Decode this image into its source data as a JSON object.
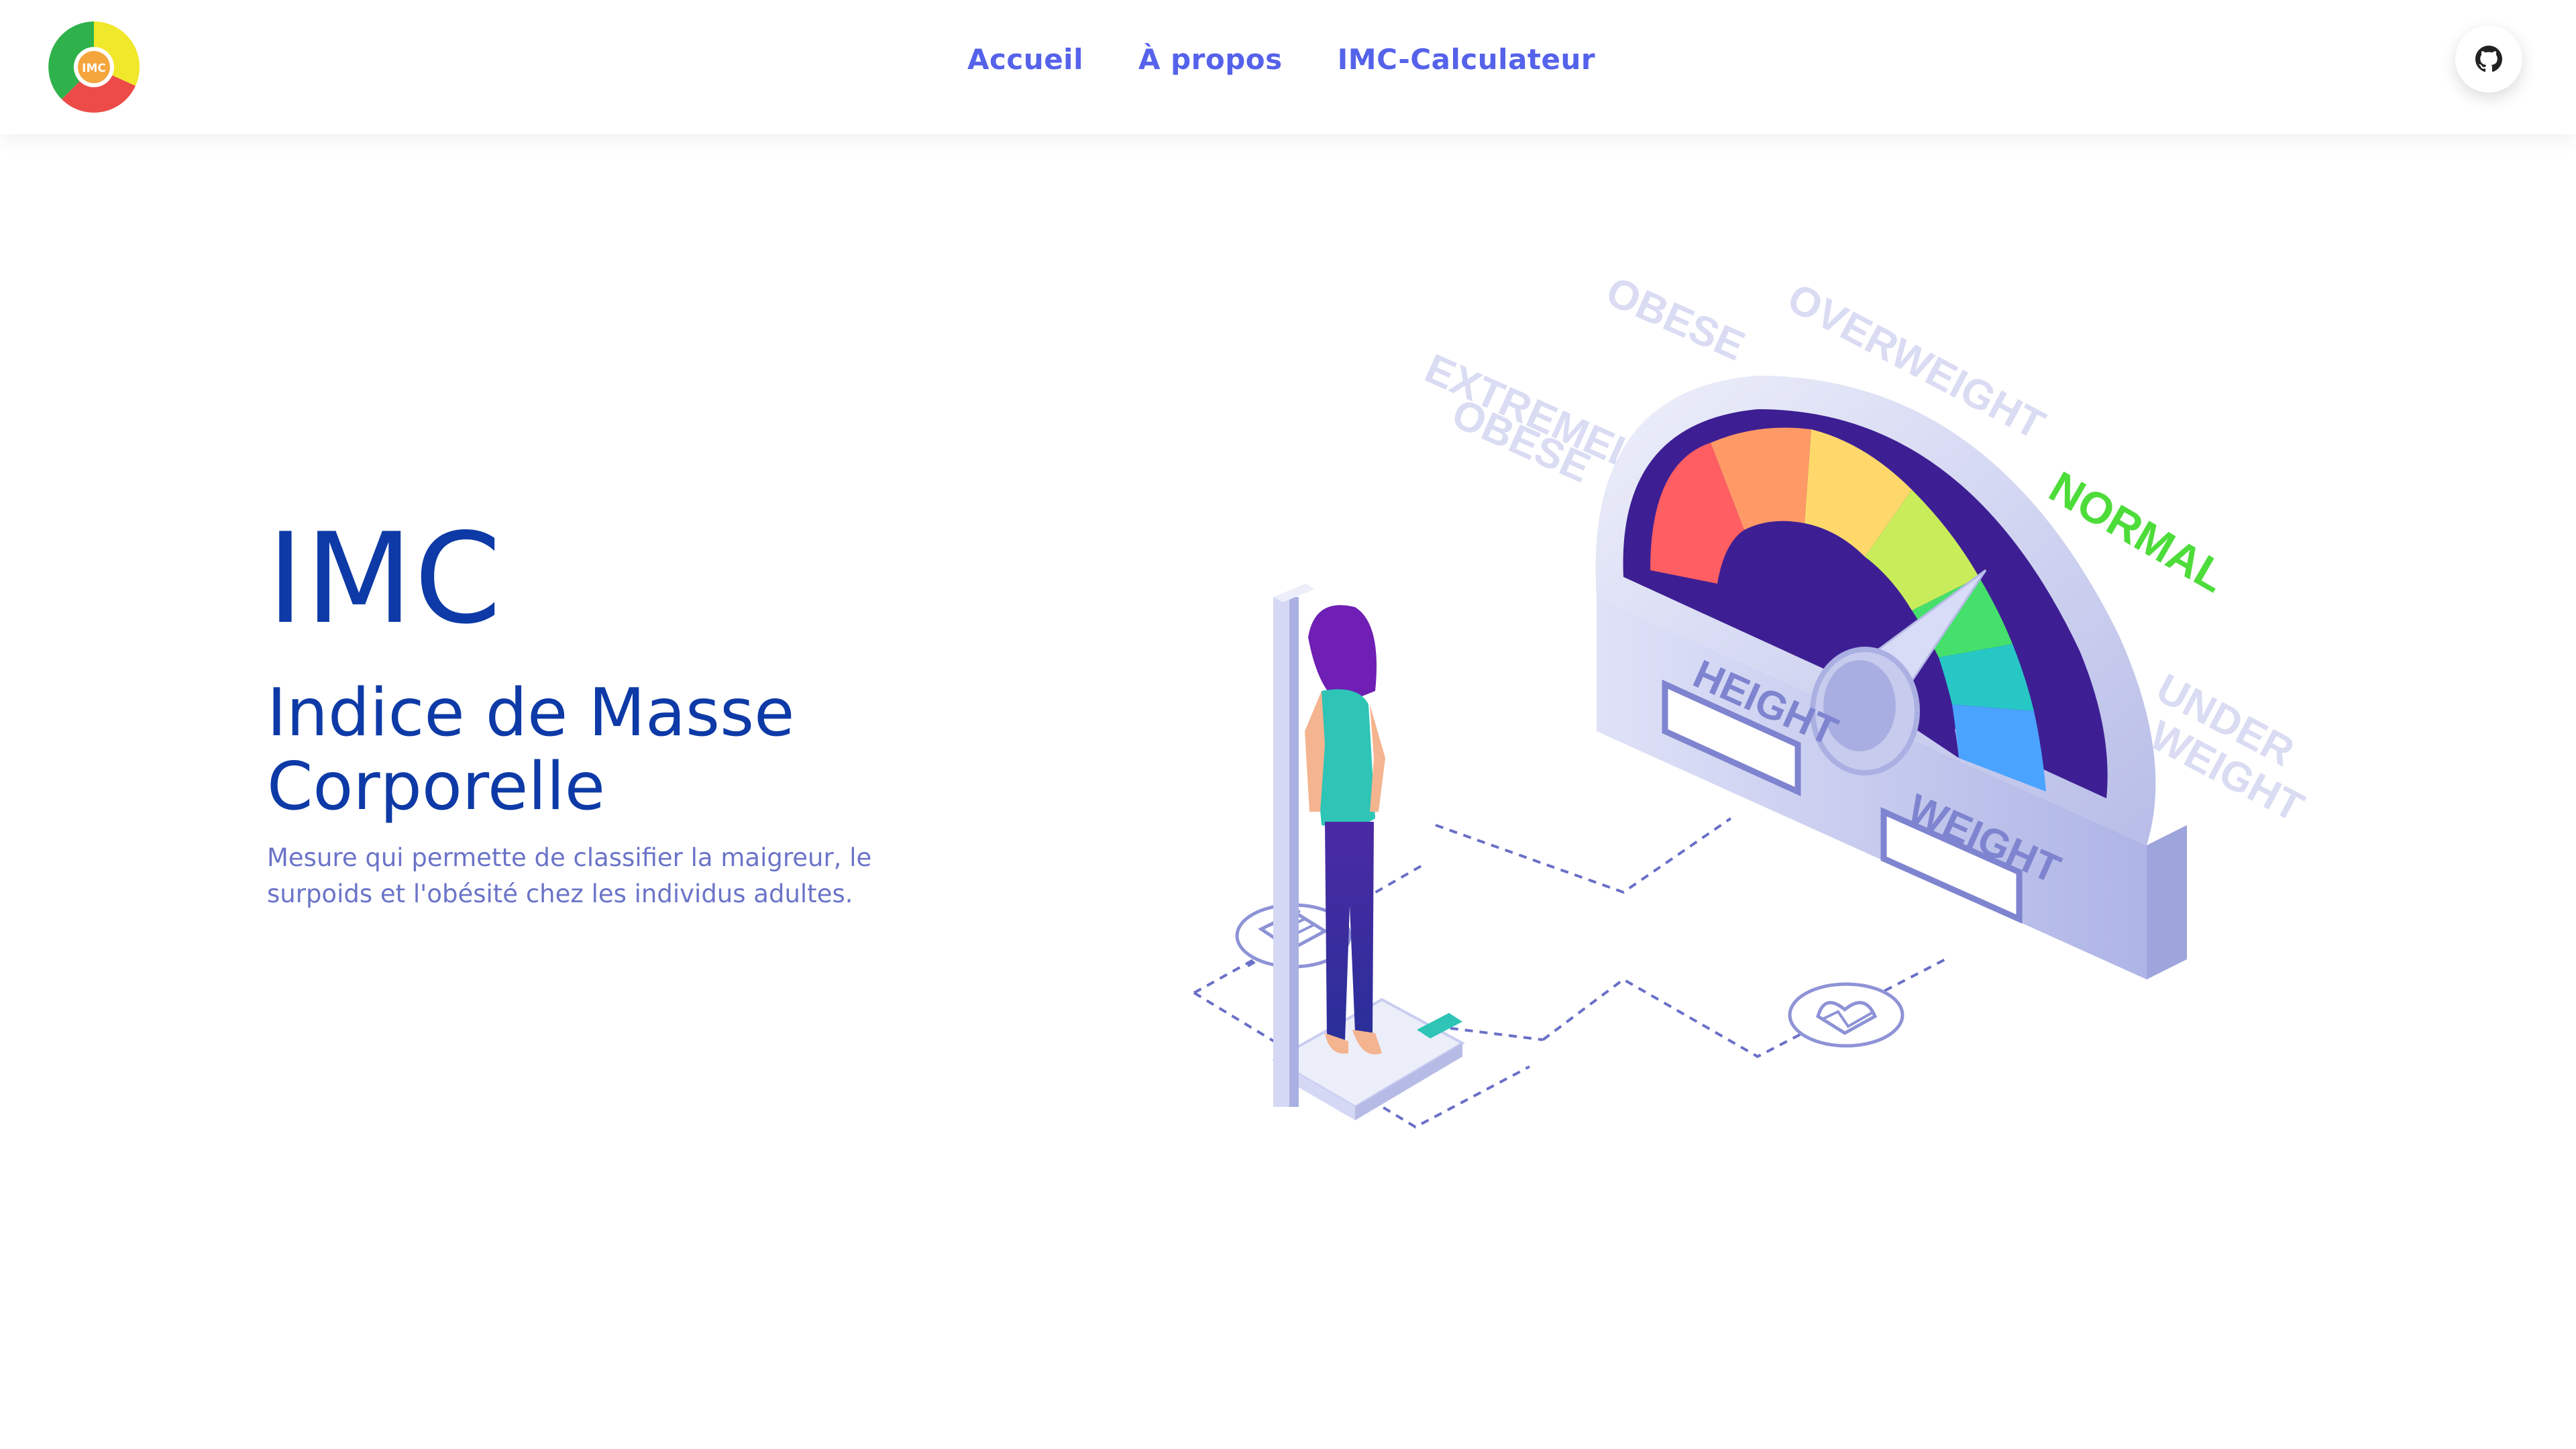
{
  "app": {
    "logo_text": "IMC"
  },
  "nav": {
    "links": [
      {
        "label": "Accueil"
      },
      {
        "label": "À propos"
      },
      {
        "label": "IMC-Calculateur"
      }
    ],
    "github_icon": "github-icon"
  },
  "hero": {
    "title": "IMC",
    "subtitle": "Indice de Masse Corporelle",
    "description": "Mesure qui permette de classifier la maigreur, le surpoids et l'obésité chez les individus adultes."
  },
  "illustration": {
    "labels": {
      "extremely": "EXTREMELY",
      "obese_small": "OBESE",
      "obese": "OBESE",
      "overweight": "OVERWEIGHT",
      "normal": "NORMAL",
      "under": "UNDER",
      "weight_cat": "WEIGHT",
      "height": "HEIGHT",
      "weight": "WEIGHT"
    },
    "gauge_colors": [
      "#ff5e62",
      "#ff9966",
      "#ffd86b",
      "#c9ec5a",
      "#45e06b",
      "#27c7c6",
      "#4aa3ff"
    ]
  },
  "colors": {
    "primary": "#0d3aa6",
    "nav_link": "#5562ea",
    "description": "#6b74c8",
    "normal_label": "#4ddc3a"
  }
}
